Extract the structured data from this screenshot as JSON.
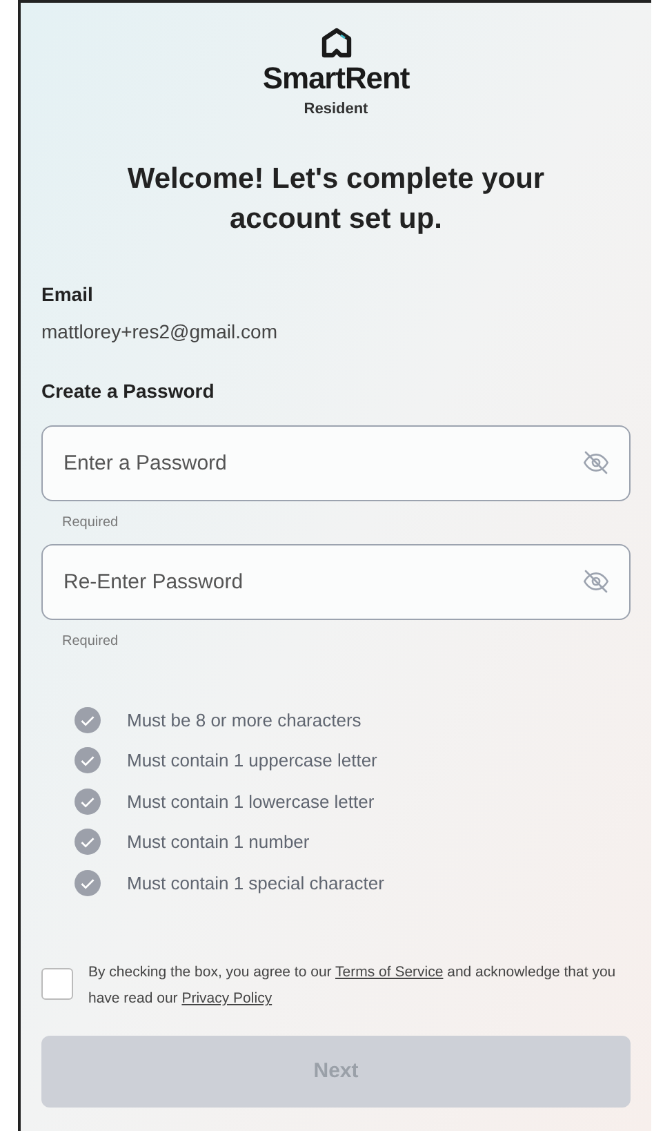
{
  "brand": {
    "name": "SmartRent",
    "subtitle": "Resident"
  },
  "heading": "Welcome! Let's complete your account set up.",
  "email": {
    "label": "Email",
    "value": "mattlorey+res2@gmail.com"
  },
  "password_section": {
    "label": "Create a Password"
  },
  "fields": [
    {
      "placeholder": "Enter a Password",
      "helper": "Required",
      "visible": false
    },
    {
      "placeholder": "Re-Enter Password",
      "helper": "Required",
      "visible": false
    }
  ],
  "requirements": [
    {
      "text": "Must be 8 or more characters",
      "met": false
    },
    {
      "text": "Must contain 1 uppercase letter",
      "met": false
    },
    {
      "text": "Must contain 1 lowercase letter",
      "met": false
    },
    {
      "text": "Must contain 1 number",
      "met": false
    },
    {
      "text": "Must contain 1 special character",
      "met": false
    }
  ],
  "consent": {
    "checked": false,
    "parts": [
      {
        "kind": "text",
        "text": "By checking the box, you agree to our "
      },
      {
        "kind": "link",
        "text": "Terms of Service"
      },
      {
        "kind": "text",
        "text": " and acknowledge that you have read our "
      },
      {
        "kind": "link",
        "text": "Privacy Policy"
      }
    ]
  },
  "next_button": {
    "label": "Next",
    "disabled": true
  }
}
